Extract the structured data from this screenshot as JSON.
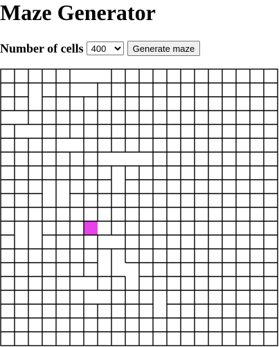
{
  "page": {
    "title": "Maze Generator"
  },
  "controls": {
    "cells_label": "Number of cells",
    "cells_value": "400",
    "cells_options": [
      "400"
    ],
    "generate_label": "Generate maze"
  },
  "maze": {
    "columns": 20,
    "rows": 20,
    "wall_color": "#000000",
    "current_cell_color": "#e842e8",
    "current_cell": {
      "col": 6,
      "row": 11
    }
  }
}
